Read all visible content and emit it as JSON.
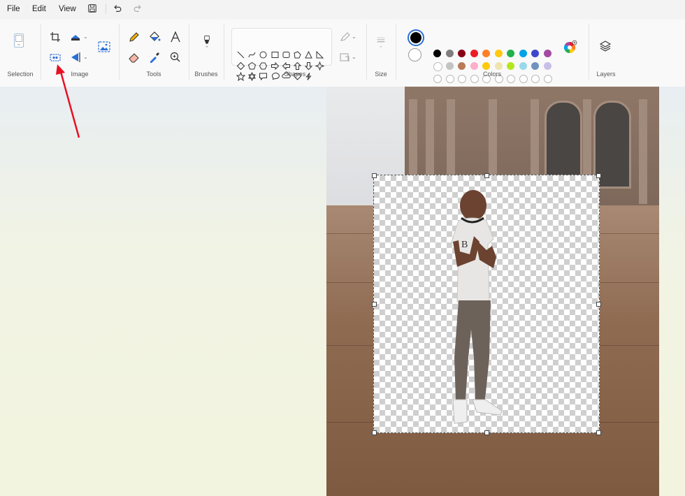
{
  "menu": {
    "file": "File",
    "edit": "Edit",
    "view": "View"
  },
  "quick_access": {
    "save_icon": "save-icon",
    "undo_icon": "undo-icon",
    "redo_icon": "redo-icon"
  },
  "ribbon": {
    "groups": {
      "selection": "Selection",
      "image": "Image",
      "tools": "Tools",
      "brushes": "Brushes",
      "shapes": "Shapes",
      "size": "Size",
      "colors": "Colors",
      "layers": "Layers"
    }
  },
  "colors": {
    "primary": "#000000",
    "secondary": "#ffffff",
    "palette_row1": [
      "#000000",
      "#7f7f7f",
      "#880015",
      "#ed1c24",
      "#ff7f27",
      "#ffc90e",
      "#22b14c",
      "#00a2e8",
      "#3f48cc",
      "#a349a4"
    ],
    "palette_row2": [
      "#ffffff",
      "#c3c3c3",
      "#b97a57",
      "#ffaec9",
      "#ffc90e",
      "#efe4b0",
      "#b5e61d",
      "#99d9ea",
      "#7092be",
      "#c8bfe7"
    ],
    "palette_row3_empty": 10
  },
  "annotation": {
    "arrow_color": "#e81123"
  }
}
